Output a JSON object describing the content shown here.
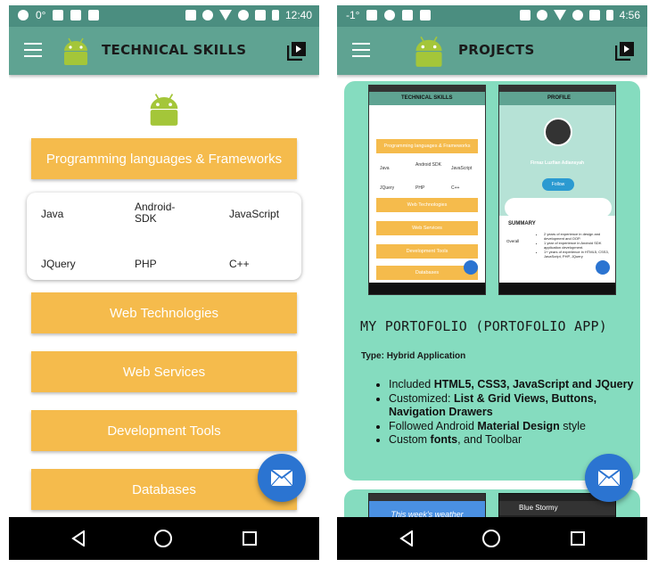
{
  "left": {
    "status": {
      "left_text": "0°",
      "time": "12:40"
    },
    "appbar": {
      "title": "TECHNICAL SKILLS"
    },
    "buttons": {
      "languages": "Programming languages & Frameworks",
      "web_tech": "Web Technologies",
      "web_services": "Web Services",
      "dev_tools": "Development Tools",
      "databases": "Databases"
    },
    "skills": [
      "Java",
      "Android-SDK",
      "JavaScript",
      "JQuery",
      "PHP",
      "C++"
    ]
  },
  "right": {
    "status": {
      "left_text": "-1°",
      "time": "4:56"
    },
    "appbar": {
      "title": "PROJECTS"
    },
    "screenshot_left": {
      "title": "TECHNICAL SKILLS",
      "buttons": [
        "Programming languages & Frameworks",
        "Web Technologies",
        "Web Services",
        "Development Tools",
        "Databases"
      ],
      "skills": [
        "Java",
        "Android SDK",
        "JavaScript",
        "JQuery",
        "PHP",
        "C++"
      ]
    },
    "screenshot_right": {
      "title": "PROFILE",
      "name": "Firnaz Luzfian Adiansyah",
      "follow": "Follow",
      "summary": "SUMMARY",
      "overall": "Overall",
      "summary_items": [
        "2 years of experience in design and development and OOP.",
        "1 year of experience in Android SDK application development.",
        "1+ years of experience in HTML5, CSS3, JavaScript, PHP, JQuery"
      ]
    },
    "project": {
      "title": "MY PORTOFOLIO (PORTOFOLIO APP)",
      "type": "Type: Hybrid Application",
      "features": [
        {
          "prefix": "Included ",
          "bold": "HTML5, CSS3, JavaScript and JQuery",
          "suffix": ""
        },
        {
          "prefix": "Customized: ",
          "bold": "List & Grid Views, Buttons, Navigation Drawers",
          "suffix": ""
        },
        {
          "prefix": "Followed Android ",
          "bold": "Material Design",
          "suffix": " style"
        },
        {
          "prefix": "Custom ",
          "bold": "fonts",
          "suffix": ", and Toolbar"
        }
      ]
    },
    "next_card": {
      "weather_text": "This week's weather",
      "app_title": "Blue Stormy"
    }
  },
  "colors": {
    "primary": "#5fa392",
    "status": "#4b8e80",
    "accent_yellow": "#f5bb4c",
    "fab_blue": "#2b74d1",
    "card_mint": "#85dcbf",
    "android_green": "#a4c639"
  },
  "icons": [
    "menu-icon",
    "android-logo-icon",
    "play-square-icon",
    "mail-icon",
    "back-icon",
    "home-icon",
    "recent-apps-icon"
  ]
}
